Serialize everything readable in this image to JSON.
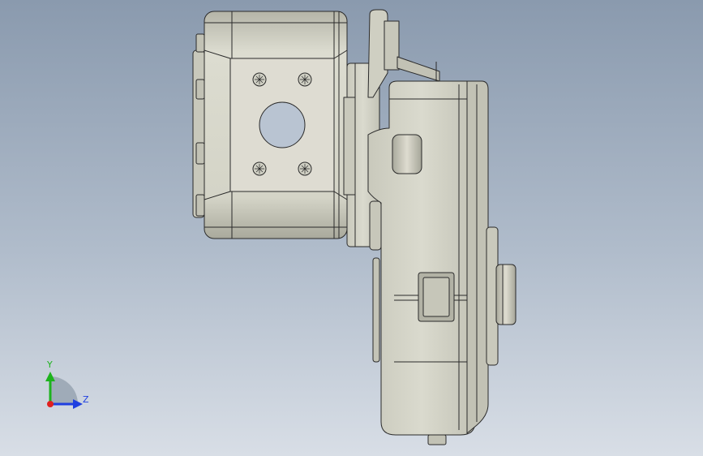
{
  "viewport": {
    "background_top": "#8a9aae",
    "background_bottom": "#d8dee6"
  },
  "model": {
    "part_fill": "#d3d3c6",
    "part_shade": "#b6b6a8",
    "edge_color": "#2a2a2a"
  },
  "triad": {
    "y_label": "Y",
    "z_label": "Z",
    "y_color": "#1db31d",
    "z_color": "#1f3fe0",
    "x_color": "#e02020"
  }
}
